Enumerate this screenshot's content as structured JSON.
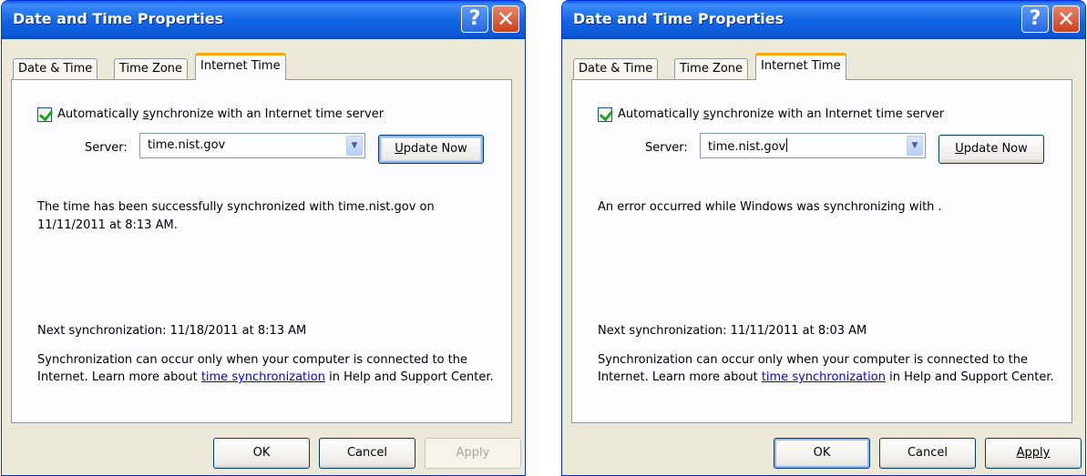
{
  "dialogs": [
    {
      "title": "Date and Time Properties",
      "help_glyph": "?",
      "close_glyph": "✕",
      "tabs": [
        "Date & Time",
        "Time Zone",
        "Internet Time"
      ],
      "active_tab": "Internet Time",
      "checkbox": {
        "checked": true,
        "pre": "Automatically ",
        "accel": "s",
        "post": "ynchronize with an Internet time server"
      },
      "server_label": "Server:",
      "server_value": "time.nist.gov",
      "update_button": {
        "accel": "U",
        "rest": "pdate Now"
      },
      "status_text": "The time has been successfully synchronized with time.nist.gov on 11/11/2011 at 8:13 AM.",
      "next_sync": "Next synchronization: 11/18/2011 at 8:13 AM",
      "note_pre": "Synchronization can occur only when your computer is connected to the Internet.  Learn more about ",
      "note_link": "time synchronization",
      "note_post": " in Help and Support Center.",
      "buttons": {
        "ok": "OK",
        "cancel": "Cancel",
        "apply": "Apply"
      },
      "apply_enabled": false
    },
    {
      "title": "Date and Time Properties",
      "help_glyph": "?",
      "close_glyph": "✕",
      "tabs": [
        "Date & Time",
        "Time Zone",
        "Internet Time"
      ],
      "active_tab": "Internet Time",
      "checkbox": {
        "checked": true,
        "pre": "Automatically ",
        "accel": "s",
        "post": "ynchronize with an Internet time server"
      },
      "server_label": "Server:",
      "server_value": "time.nist.gov",
      "update_button": {
        "accel": "U",
        "rest": "pdate Now"
      },
      "status_text": "An error occurred while Windows was synchronizing with .",
      "next_sync": "Next synchronization: 11/11/2011 at 8:03 AM",
      "note_pre": "Synchronization can occur only when your computer is connected to the Internet.  Learn more about ",
      "note_link": "time synchronization",
      "note_post": " in Help and Support Center.",
      "buttons": {
        "ok": "OK",
        "cancel": "Cancel",
        "apply": "Apply"
      },
      "apply_enabled": true
    }
  ],
  "colors": {
    "title_bar": "#0a5ee6",
    "dialog_face": "#ece9d8",
    "active_tab_accent": "#f5a70a",
    "link": "#0000ff",
    "check": "#21a121",
    "close_button": "#c9421d"
  }
}
